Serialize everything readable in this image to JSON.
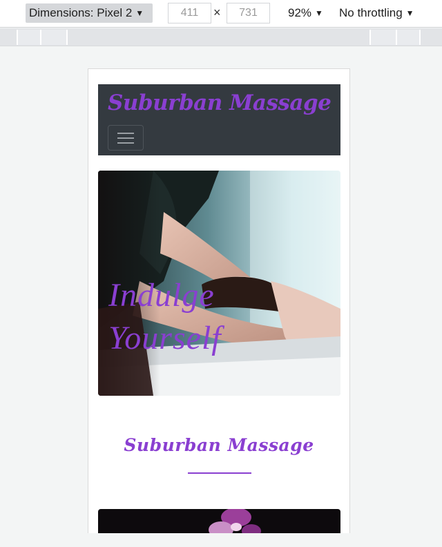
{
  "devtools": {
    "device_label": "Dimensions: Pixel 2",
    "width": "411",
    "height": "731",
    "times": "×",
    "zoom": "92%",
    "throttling": "No throttling",
    "caret": "▼"
  },
  "site": {
    "brand": "Suburban Massage",
    "hero_title_line1": "Indulge",
    "hero_title_line2": "Yourself",
    "section_title": "Suburban Massage"
  },
  "colors": {
    "accent": "#8a3fd1",
    "navbar": "#343a40"
  },
  "icons": {
    "menu": "hamburger-icon",
    "dropdown": "caret-down-icon"
  }
}
